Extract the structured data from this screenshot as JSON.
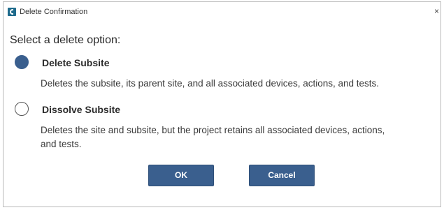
{
  "window": {
    "title": "Delete Confirmation",
    "close_glyph": "×",
    "app_icon": "app-logo-icon"
  },
  "prompt": "Select a delete option:",
  "options": [
    {
      "label": "Delete Subsite",
      "description": "Deletes the subsite, its parent site, and all associated devices, actions, and tests.",
      "selected": true
    },
    {
      "label": "Dissolve Subsite",
      "description_line1": "Deletes the site and subsite, but the project retains all associated devices, actions,",
      "description_line2": "and tests.",
      "selected": false
    }
  ],
  "buttons": {
    "ok_label": "OK",
    "cancel_label": "Cancel"
  },
  "colors": {
    "accent": "#3a5f8e",
    "icon": "#1f6b8c"
  }
}
